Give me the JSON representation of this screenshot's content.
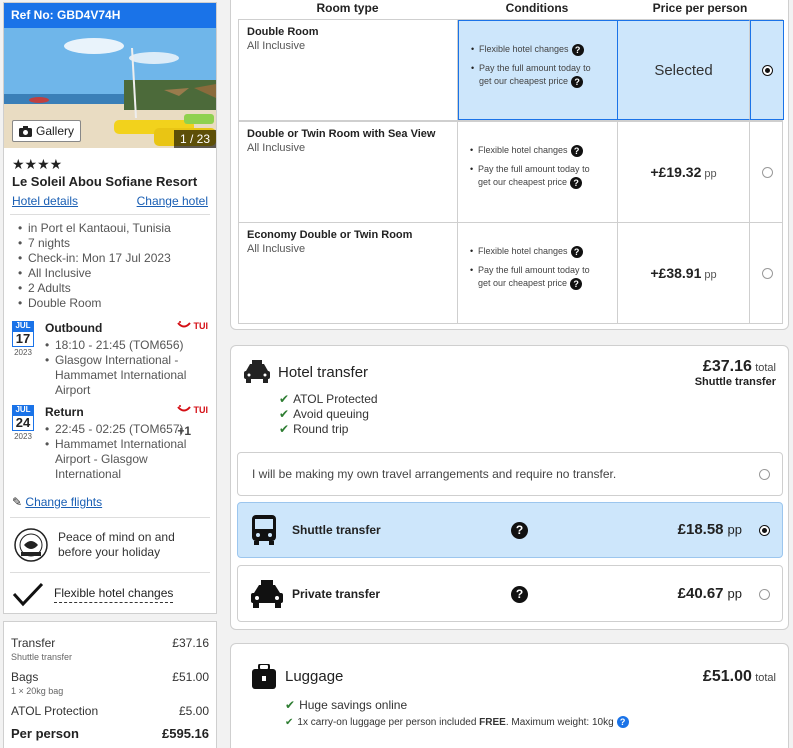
{
  "sidebar": {
    "ref": "Ref No: GBD4V74H",
    "gallery_label": "Gallery",
    "photo_count": "1 / 23",
    "stars": "★★★★",
    "hotel_name": "Le Soleil Abou Sofiane Resort",
    "hotel_details_link": "Hotel details",
    "change_hotel_link": "Change hotel",
    "details": [
      "in Port el Kantaoui, Tunisia",
      "7 nights",
      "Check-in: Mon 17 Jul 2023",
      "All Inclusive",
      "2 Adults",
      "Double Room"
    ],
    "outbound": {
      "month": "JUL",
      "day": "17",
      "year": "2023",
      "title": "Outbound",
      "airline": "TUI",
      "time": "18:10 - 21:45 (TOM656)",
      "route_1": "Glasgow International -",
      "route_2": "Hammamet International",
      "route_3": "Airport"
    },
    "return": {
      "month": "JUL",
      "day": "24",
      "year": "2023",
      "title": "Return",
      "airline": "TUI",
      "time": "22:45 - 02:25 (TOM657)",
      "plus_day": "+1",
      "route_1": "Hammamet International",
      "route_2": "Airport - Glasgow",
      "route_3": "International"
    },
    "change_flights": "Change flights",
    "peace_line_1": "Peace of mind on and",
    "peace_line_2": "before your holiday",
    "flexible_changes": "Flexible hotel changes"
  },
  "pricing": {
    "transfer_label": "Transfer",
    "transfer_value": "£37.16",
    "transfer_sub": "Shuttle transfer",
    "bags_label": "Bags",
    "bags_value": "£51.00",
    "bags_sub": "1 × 20kg bag",
    "atol_label": "ATOL Protection",
    "atol_value": "£5.00",
    "per_person_label": "Per person",
    "per_person_value": "£595.16"
  },
  "rooms": {
    "headers": [
      "Room type",
      "Conditions",
      "Price per person"
    ],
    "cond_1": "Flexible hotel changes",
    "cond_2a": "Pay the full amount today to",
    "cond_2b": "get our cheapest price",
    "items": [
      {
        "name": "Double Room",
        "board": "All Inclusive",
        "price": "Selected",
        "pp": ""
      },
      {
        "name": "Double or Twin Room with Sea View",
        "board": "All Inclusive",
        "price": "+£19.32",
        "pp": "pp"
      },
      {
        "name": "Economy Double or Twin Room",
        "board": "All Inclusive",
        "price": "+£38.91",
        "pp": "pp"
      }
    ]
  },
  "transfer": {
    "title": "Hotel transfer",
    "total_price": "£37.16",
    "total_label": "total",
    "total_sub": "Shuttle transfer",
    "benefits": [
      "ATOL Protected",
      "Avoid queuing",
      "Round trip"
    ],
    "no_transfer": "I will be making my own travel arrangements and require no transfer.",
    "shuttle_label": "Shuttle transfer",
    "shuttle_price": "£18.58",
    "private_label": "Private transfer",
    "private_price": "£40.67",
    "pp": "pp"
  },
  "luggage": {
    "title": "Luggage",
    "total_price": "£51.00",
    "total_label": "total",
    "benefit_1": "Huge savings online",
    "benefit_2a": "1x carry-on luggage per person included ",
    "benefit_2b": "FREE",
    "benefit_2c": ". Maximum weight: 10kg"
  },
  "colors": {
    "accent": "#1a73e8",
    "selected_bg": "#cde6fb",
    "check_green": "#2e7d32",
    "tui_red": "#d40e14"
  }
}
